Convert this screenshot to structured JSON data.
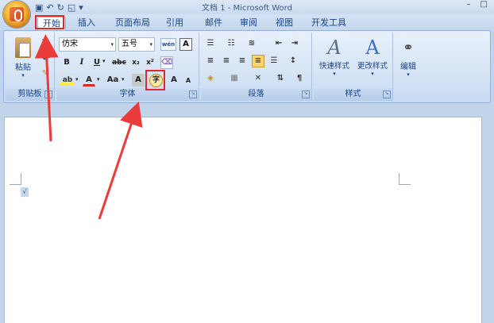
{
  "window": {
    "title": "文档 1 - Microsoft Word",
    "minimize": "–",
    "maximize": "□"
  },
  "tabs": [
    "开始",
    "插入",
    "页面布局",
    "引用",
    "邮件",
    "审阅",
    "视图",
    "开发工具"
  ],
  "clipboard": {
    "paste_label": "粘贴",
    "group_label": "剪贴板",
    "cut_icon": "✂"
  },
  "font": {
    "font_name": "仿宋",
    "font_size": "五号",
    "group_label": "字体",
    "bold": "B",
    "italic": "I",
    "underline": "U",
    "strike": "abc",
    "sub": "x₂",
    "sup": "x²",
    "highlight": "ab",
    "font_color": "A",
    "change_case": "Aa",
    "char_shading": "A",
    "enclose": "字",
    "grow": "A",
    "shrink": "A",
    "phonetic": "wén",
    "border": "A"
  },
  "paragraph": {
    "group_label": "段落"
  },
  "styles": {
    "quick_styles": "快速样式",
    "change_styles": "更改样式",
    "group_label": "样式"
  },
  "editing": {
    "label": "编辑"
  },
  "document": {
    "checkmark": "√"
  }
}
